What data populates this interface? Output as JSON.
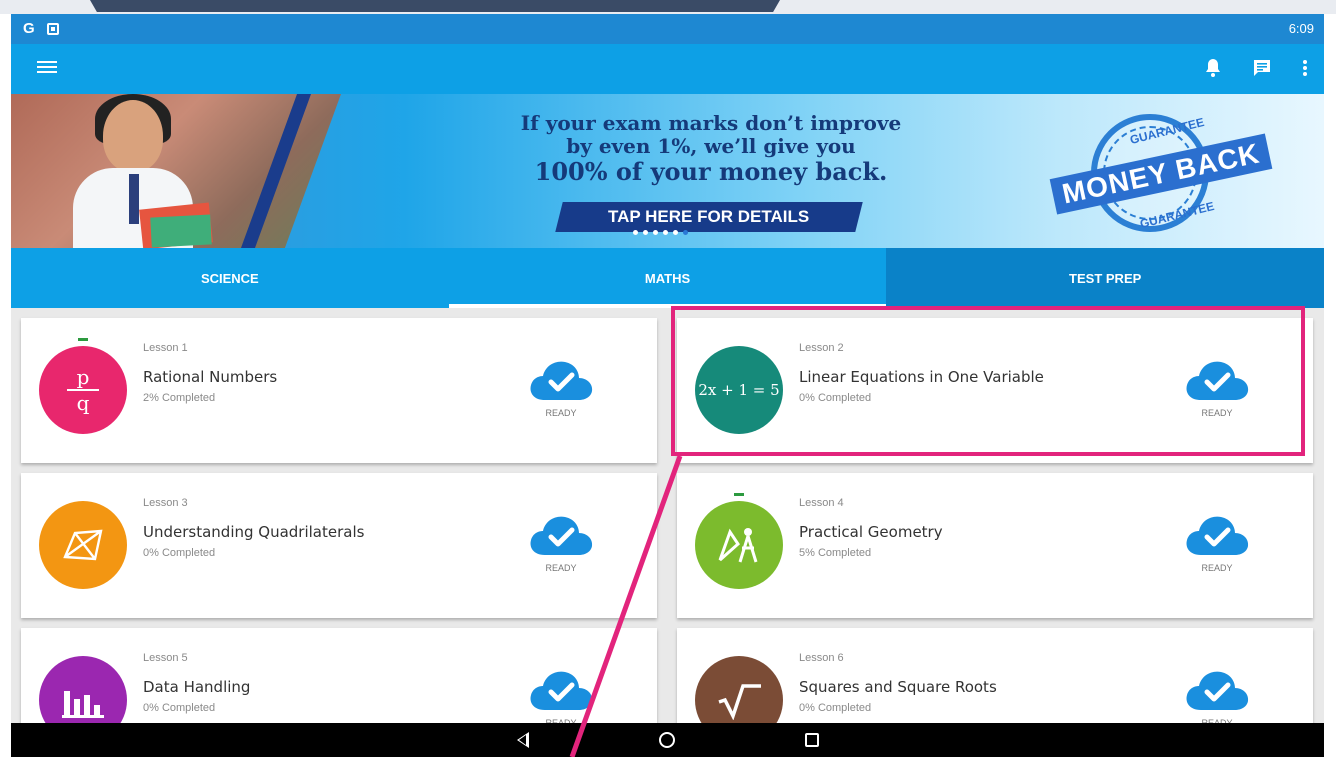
{
  "status_bar": {
    "time": "6:09",
    "icons": [
      "google-icon",
      "app-a-icon"
    ]
  },
  "toolbar": {
    "icons": [
      "hamburger-menu-icon",
      "bell-icon",
      "chat-icon",
      "more-vert-icon"
    ]
  },
  "banner": {
    "line1": "If your exam marks don’t improve",
    "line2": "by even 1%, we’ll give you",
    "line3": "100% of your money back.",
    "cta": "TAP HERE FOR DETAILS",
    "seal_ribbon": "MONEY BACK",
    "seal_top": "GUARANTEE",
    "seal_bottom": "GUARANTEE",
    "active_slide": 6,
    "slide_count": 6
  },
  "tabs": [
    {
      "label": "SCIENCE",
      "selected": false
    },
    {
      "label": "MATHS",
      "selected": true
    },
    {
      "label": "TEST PREP",
      "selected": false
    }
  ],
  "lessons": [
    {
      "lesson": "Lesson 1",
      "title": "Rational Numbers",
      "progress": "2% Completed",
      "status": "READY",
      "color": "#e8276d",
      "icon": "fraction-p-over-q-icon",
      "icon_num": "p",
      "icon_den": "q"
    },
    {
      "lesson": "Lesson 2",
      "title": "Linear Equations in One Variable",
      "progress": "0% Completed",
      "status": "READY",
      "color": "#168a7a",
      "icon": "equation-icon",
      "icon_text": "2x + 1 = 5"
    },
    {
      "lesson": "Lesson 3",
      "title": "Understanding Quadrilaterals",
      "progress": "0% Completed",
      "status": "READY",
      "color": "#f39612",
      "icon": "quadrilateral-icon"
    },
    {
      "lesson": "Lesson 4",
      "title": "Practical Geometry",
      "progress": "5% Completed",
      "status": "READY",
      "color": "#7cbb2d",
      "icon": "compass-ruler-icon"
    },
    {
      "lesson": "Lesson 5",
      "title": "Data Handling",
      "progress": "0% Completed",
      "status": "READY",
      "color": "#9b27b0",
      "icon": "bar-chart-icon"
    },
    {
      "lesson": "Lesson 6",
      "title": "Squares and Square Roots",
      "progress": "0% Completed",
      "status": "READY",
      "color": "#7b4c36",
      "icon": "square-root-icon"
    }
  ],
  "colors": {
    "status_bar": "#1e88d2",
    "toolbar": "#0da0e6",
    "highlight": "#e2247c",
    "cloud": "#1a8fde"
  }
}
